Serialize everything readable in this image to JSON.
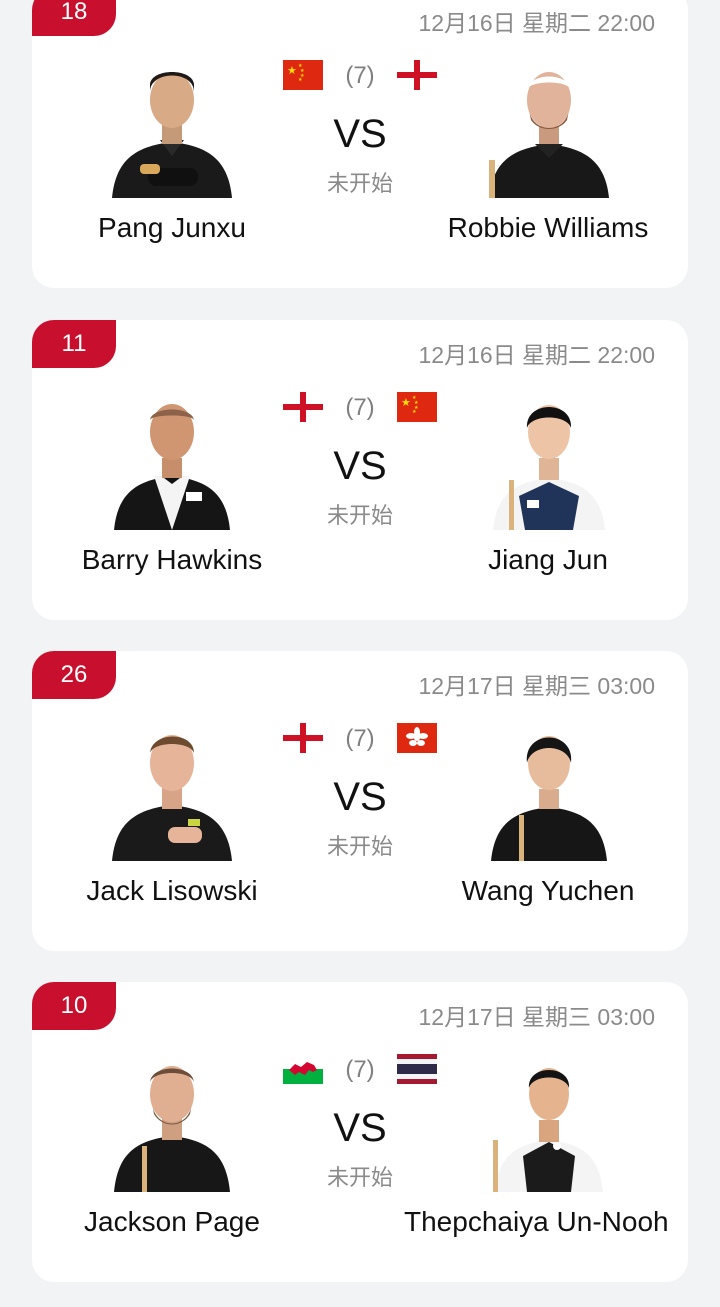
{
  "status_label": "未开始",
  "vs_label": "VS",
  "matches": [
    {
      "number": "18",
      "datetime": "12月16日 星期二 22:00",
      "seed": "(7)",
      "vs": "VS",
      "status": "未开始",
      "left": {
        "name": "Pang Junxu",
        "flag": "china-flag"
      },
      "right": {
        "name": "Robbie Williams",
        "flag": "england-flag"
      }
    },
    {
      "number": "11",
      "datetime": "12月16日 星期二 22:00",
      "seed": "(7)",
      "vs": "VS",
      "status": "未开始",
      "left": {
        "name": "Barry Hawkins",
        "flag": "england-flag"
      },
      "right": {
        "name": "Jiang Jun",
        "flag": "china-flag"
      }
    },
    {
      "number": "26",
      "datetime": "12月17日 星期三 03:00",
      "seed": "(7)",
      "vs": "VS",
      "status": "未开始",
      "left": {
        "name": "Jack Lisowski",
        "flag": "england-flag"
      },
      "right": {
        "name": "Wang Yuchen",
        "flag": "hong-kong-flag"
      }
    },
    {
      "number": "10",
      "datetime": "12月17日 星期三 03:00",
      "seed": "(7)",
      "vs": "VS",
      "status": "未开始",
      "left": {
        "name": "Jackson Page",
        "flag": "wales-flag"
      },
      "right": {
        "name": "Thepchaiya Un-Nooh",
        "flag": "thailand-flag"
      }
    }
  ],
  "colors": {
    "accent": "#c8102e",
    "background": "#f2f3f5",
    "card": "#ffffff",
    "text": "#111111",
    "muted": "#8a8a8a"
  }
}
